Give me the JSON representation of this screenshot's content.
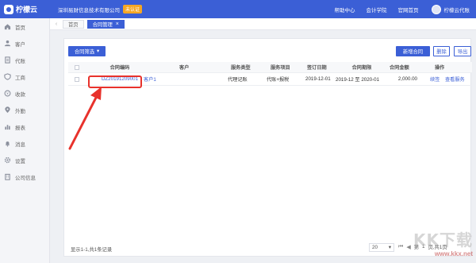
{
  "app": {
    "logo_text": "柠檬云",
    "company": "深圳易财信息技术有限公司",
    "unverified_badge": "未认证",
    "links": [
      "帮助中心",
      "会计学院",
      "官网首页"
    ],
    "user_name": "柠檬云代账"
  },
  "sidebar": {
    "items": [
      {
        "label": "首页",
        "icon": "home-icon"
      },
      {
        "label": "客户",
        "icon": "users-icon"
      },
      {
        "label": "代账",
        "icon": "ledger-icon"
      },
      {
        "label": "工商",
        "icon": "shield-icon"
      },
      {
        "label": "收款",
        "icon": "coin-icon"
      },
      {
        "label": "外勤",
        "icon": "location-icon"
      },
      {
        "label": "报表",
        "icon": "chart-icon"
      },
      {
        "label": "消息",
        "icon": "bell-icon"
      },
      {
        "label": "设置",
        "icon": "gear-icon"
      },
      {
        "label": "公司信息",
        "icon": "building-icon"
      }
    ]
  },
  "tabs": [
    {
      "label": "首页"
    },
    {
      "label": "合同管理"
    }
  ],
  "toolbar": {
    "filter_label": "合同筛选",
    "new_label": "新增合同",
    "delete_label": "删除",
    "export_label": "导出"
  },
  "table": {
    "headers": [
      "合同编码",
      "客户",
      "服务类型",
      "服务项目",
      "签订日期",
      "合同期限",
      "合同金额",
      "操作"
    ],
    "rows": [
      {
        "code": "DZ20191209001",
        "customer": "客户1",
        "service_type": "代理记账",
        "service_item": "代账+报税",
        "sign_date": "2019-12-01",
        "term": "2019-12 至 2020-01",
        "amount": "2,000.00",
        "action_renew": "续签",
        "action_view": "查看服务"
      }
    ]
  },
  "footer": {
    "info": "显示1-1,共1条记录",
    "page_size": "20",
    "page_label_pre": "第",
    "current_page": "1",
    "page_label_post": "页,共1页",
    "page_total_suffix": "共1页"
  },
  "watermark": {
    "logo": "KK下载",
    "url": "www.kkx.net"
  }
}
